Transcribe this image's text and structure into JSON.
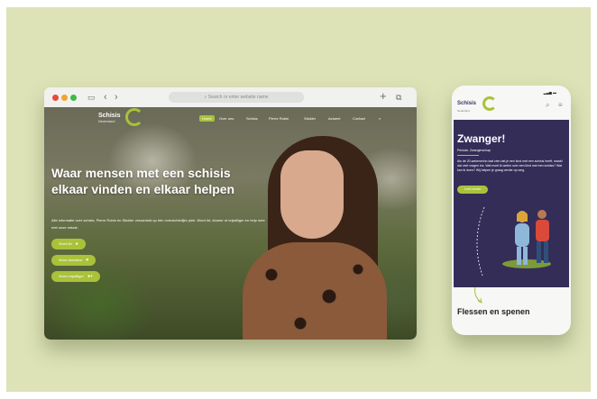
{
  "desktop": {
    "url_placeholder": "Search or enter website name",
    "logo": {
      "title": "Schisis",
      "subtitle": "Nederland"
    },
    "nav": [
      "Home",
      "Over ons",
      "Schisis",
      "Pierre Robin",
      "Stickler",
      "Actueel",
      "Contact"
    ],
    "hero_title": "Waar mensen met een schisis elkaar vinden en elkaar helpen",
    "hero_text": "Alle informatie over schisis, Pierre Robin en Stickler verzameld op één overzichtelijke plek. Word lid, doneer of vrijwilliger en help mee met onze missie.",
    "buttons": [
      "Word lid",
      "Word donateur",
      "Word vrijwilliger"
    ]
  },
  "mobile": {
    "logo": {
      "title": "Schisis",
      "subtitle": "Nederland"
    },
    "title": "Zwanger!",
    "breadcrumb": "Periode, Zwangerschap",
    "text": "Als de 20-wekenecho laat zien dat je een kind met een schisis heeft, maakt dat veel vragen los. Wat moet ik weten over een kind met een schisis? Wat kan ik doen? Wij helpen je graag verder op weg.",
    "button": "Lees verder",
    "footer_heading": "Flessen en spenen"
  },
  "colors": {
    "brand_green": "#a9c23a",
    "brand_purple": "#332d58",
    "background": "#dde3b7"
  }
}
